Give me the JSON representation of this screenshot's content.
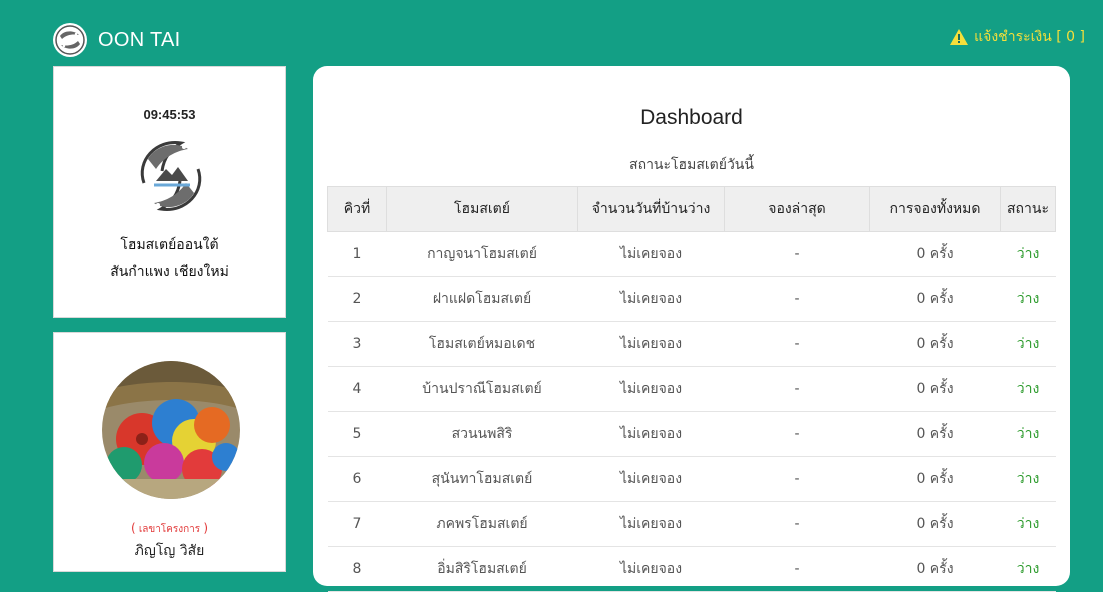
{
  "header": {
    "brand": "OON TAI",
    "notification": "แจ้งชำระเงิน [ 0 ]"
  },
  "sidebar": {
    "clock": "09:45:53",
    "homestay_name_line1": "โฮมสเตย์ออนใต้",
    "homestay_name_line2": "สันกำแพง เชียงใหม่",
    "profile": {
      "role_open": "(",
      "role": "เลขาโครงการ",
      "role_close": ")",
      "name": "ภิญโญ วิสัย"
    }
  },
  "main": {
    "title": "Dashboard",
    "subtitle": "สถานะโฮมสเตย์วันนี้",
    "columns": [
      "คิวที่",
      "โฮมสเตย์",
      "จำนวนวันที่บ้านว่าง",
      "จองล่าสุด",
      "การจองทั้งหมด",
      "สถานะ"
    ],
    "rows": [
      {
        "queue": "1",
        "name": "กาญจนาโฮมสเตย์",
        "free_days": "ไม่เคยจอง",
        "latest": "-",
        "total": "0 ครั้ง",
        "status": "ว่าง"
      },
      {
        "queue": "2",
        "name": "ฝาแฝดโฮมสเตย์",
        "free_days": "ไม่เคยจอง",
        "latest": "-",
        "total": "0 ครั้ง",
        "status": "ว่าง"
      },
      {
        "queue": "3",
        "name": "โฮมสเตย์หมอเดช",
        "free_days": "ไม่เคยจอง",
        "latest": "-",
        "total": "0 ครั้ง",
        "status": "ว่าง"
      },
      {
        "queue": "4",
        "name": "บ้านปราณีโฮมสเตย์",
        "free_days": "ไม่เคยจอง",
        "latest": "-",
        "total": "0 ครั้ง",
        "status": "ว่าง"
      },
      {
        "queue": "5",
        "name": "สวนนพสิริ",
        "free_days": "ไม่เคยจอง",
        "latest": "-",
        "total": "0 ครั้ง",
        "status": "ว่าง"
      },
      {
        "queue": "6",
        "name": "สุนันทาโฮมสเตย์",
        "free_days": "ไม่เคยจอง",
        "latest": "-",
        "total": "0 ครั้ง",
        "status": "ว่าง"
      },
      {
        "queue": "7",
        "name": "ภคพรโฮมสเตย์",
        "free_days": "ไม่เคยจอง",
        "latest": "-",
        "total": "0 ครั้ง",
        "status": "ว่าง"
      },
      {
        "queue": "8",
        "name": "อิ่มสิริโฮมสเตย์",
        "free_days": "ไม่เคยจอง",
        "latest": "-",
        "total": "0 ครั้ง",
        "status": "ว่าง"
      }
    ]
  },
  "icons": {
    "brand_logo": "fish-logo-icon",
    "alert": "warning-triangle-icon",
    "homestay_logo": "fish-mountain-logo-icon"
  },
  "colors": {
    "background": "#139f85",
    "alert": "#f6df3a",
    "status_free": "#2b9a2b",
    "role": "#e23b3b"
  }
}
